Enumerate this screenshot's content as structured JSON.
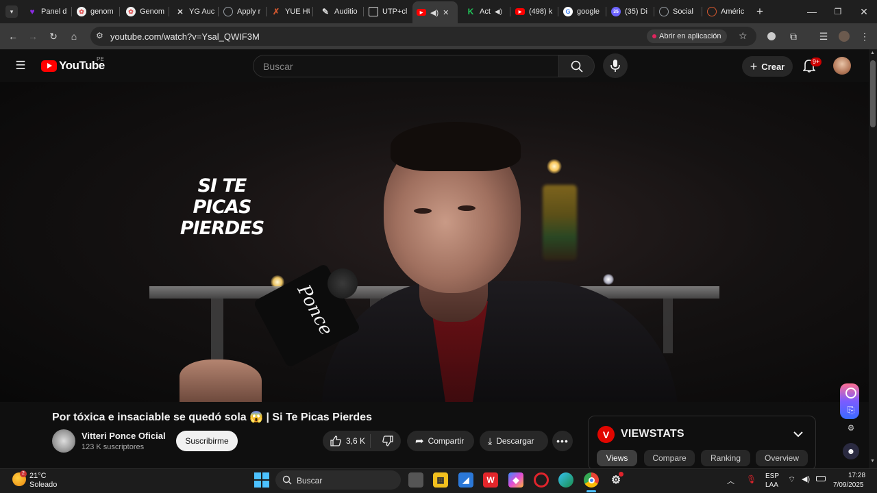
{
  "browser": {
    "tabs": [
      {
        "label": "Panel d",
        "icon": "heart-icon",
        "color": "#8a2be2"
      },
      {
        "label": "genom",
        "icon": "web-icon",
        "color": "#e25555"
      },
      {
        "label": "Genom",
        "icon": "web-icon",
        "color": "#e25555"
      },
      {
        "label": "YG Auc",
        "icon": "yg-icon",
        "color": "#dddddd"
      },
      {
        "label": "Apply r",
        "icon": "globe-icon",
        "color": "#9aa0a6"
      },
      {
        "label": "YUE HU",
        "icon": "x-icon",
        "color": "#d4582f"
      },
      {
        "label": "Auditio",
        "icon": "pen-icon",
        "color": "#dddddd"
      },
      {
        "label": "UTP+cl",
        "icon": "grid-icon",
        "color": "#dddddd"
      },
      {
        "label": "",
        "icon": "youtube-icon",
        "color": "#ff0000"
      },
      {
        "label": "Act",
        "icon": "k-icon",
        "color": "#20c95a"
      },
      {
        "label": "(498) k",
        "icon": "youtube-icon",
        "color": "#ff0000"
      },
      {
        "label": "google",
        "icon": "google-icon",
        "color": "#4285f4"
      },
      {
        "label": "(35) Di",
        "icon": "discord-icon",
        "color": "#6c63ff"
      },
      {
        "label": "Social",
        "icon": "globe-icon",
        "color": "#9aa0a6"
      },
      {
        "label": "Améric",
        "icon": "globe-icon",
        "color": "#d4582f"
      }
    ],
    "url": "youtube.com/watch?v=Ysal_QWIF3M",
    "open_in_app": "Abrir en aplicación"
  },
  "youtube": {
    "logo_text": "YouTube",
    "country_code": "PE",
    "search_placeholder": "Buscar",
    "create_label": "Crear",
    "notifications_badge": "9+"
  },
  "video": {
    "brand_line1": "SI TE PICAS",
    "brand_line2": "PIERDES",
    "title": "Por tóxica e insaciable se quedó sola 😱 | Si Te Picas Pierdes",
    "channel_name": "Vitteri Ponce Oficial",
    "subscribers": "123 K suscriptores",
    "subscribe_label": "Suscribirme",
    "likes": "3,6 K",
    "share_label": "Compartir",
    "download_label": "Descargar"
  },
  "viewstats": {
    "logo_letter": "V",
    "title": "VIEWSTATS",
    "tabs": [
      "Views",
      "Compare",
      "Ranking",
      "Overview"
    ],
    "selected_tab": "Views"
  },
  "taskbar": {
    "weather_temp": "21°C",
    "weather_desc": "Soleado",
    "search_label": "Buscar",
    "lang_line1": "ESP",
    "lang_line2": "LAA",
    "time": "17:28",
    "date": "7/09/2025"
  }
}
